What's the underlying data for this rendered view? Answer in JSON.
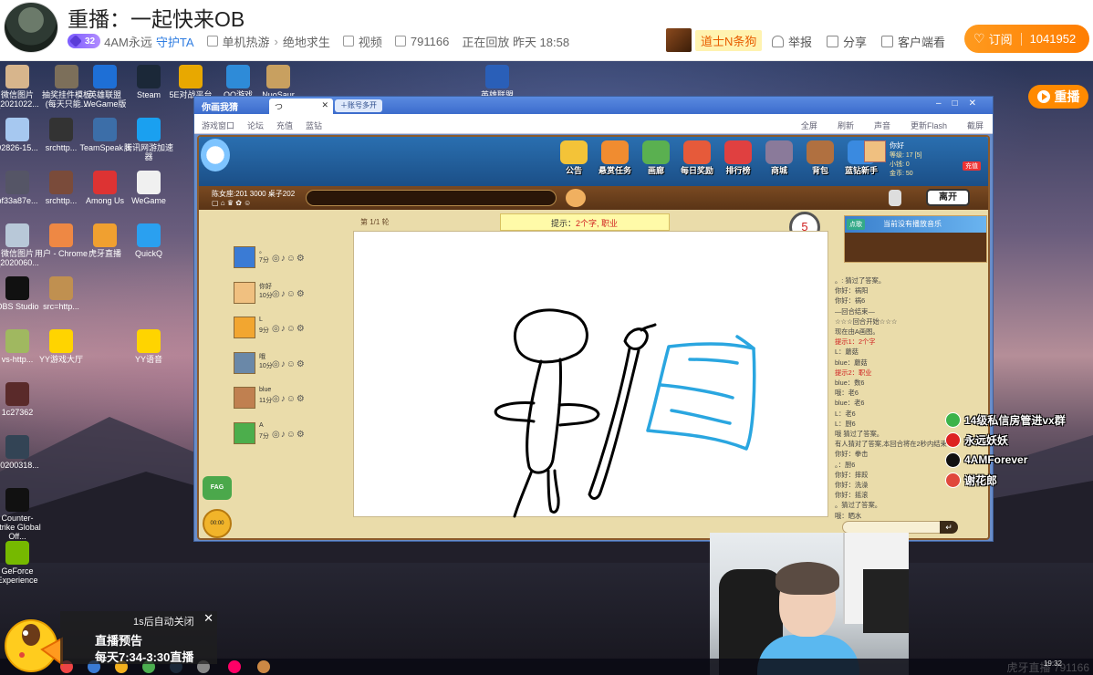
{
  "header": {
    "title": "重播：一起快来OB",
    "level": "32",
    "streamer": "4AM永远",
    "guard": "守护TA",
    "category_1": "单机热游",
    "category_2": "绝地求生",
    "video_label": "视频",
    "room_id": "791166",
    "status": "正在回放 昨天 18:58",
    "sponsor_name": "道士N条狗",
    "report": "举报",
    "share": "分享",
    "client_watch": "客户端看",
    "subscribe_label": "订阅",
    "subscribe_count": "1041952"
  },
  "stream": {
    "replay_label": "重播",
    "desktop_icons": [
      {
        "label": "微信图片_2021022..."
      },
      {
        "label": "抽奖挂件模板 (每天只能..."
      },
      {
        "label": "英雄联盟 WeGame版"
      },
      {
        "label": "Steam"
      },
      {
        "label": "5E对战平台"
      },
      {
        "label": "QQ游戏"
      },
      {
        "label": "NuoSaur"
      },
      {
        "label": "英雄联盟"
      },
      {
        "label": "92826-15..."
      },
      {
        "label": "srchttp..."
      },
      {
        "label": "TeamSpeak 3"
      },
      {
        "label": "腾讯网游加速器"
      },
      {
        "label": "bf33a87e..."
      },
      {
        "label": "srchttp..."
      },
      {
        "label": "Among Us"
      },
      {
        "label": "WeGame"
      },
      {
        "label": "微信图片_2020060..."
      },
      {
        "label": "用户 - Chrome"
      },
      {
        "label": "虎牙直播"
      },
      {
        "label": "QuickQ"
      },
      {
        "label": "OBS Studio"
      },
      {
        "label": "src=http..."
      },
      {
        "label": "vs-http..."
      },
      {
        "label": "YY游戏大厅"
      },
      {
        "label": "YY语音"
      },
      {
        "label": "1c27362"
      },
      {
        "label": "20200318..."
      },
      {
        "label": "Counter-Strike Global Off..."
      },
      {
        "label": "GeForce Experience"
      }
    ],
    "game_window": {
      "title": "你画我猜",
      "tab_label": "つ",
      "new_tab": "账号多开",
      "toolbar_links": [
        "游戏窗口",
        "论坛",
        "充值",
        "蓝钻"
      ],
      "toolbar_tools": [
        "全屏",
        "刷新",
        "声音",
        "更新Flash",
        "截屏"
      ],
      "menu": [
        "公告",
        "悬赏任务",
        "画廊",
        "每日奖励",
        "排行榜",
        "商城",
        "背包",
        "蓝钻新手"
      ],
      "user_name": "你好",
      "user_stats": [
        "等级: 17 [5]",
        "小钱: 0",
        "金币: 50"
      ],
      "recharge": "充值",
      "room": "陈女座:201 3000 桌子202",
      "leave": "离开",
      "round": "第 1/1 轮",
      "hint_prefix": "提示：",
      "hint_value": "2个字, 职业",
      "timer": "5",
      "music_label": "点歌",
      "music_text": "当前没有播放音乐",
      "fag": "FAG",
      "clock": "00:00",
      "players": [
        {
          "name": "。",
          "score": "7分"
        },
        {
          "name": "你好",
          "score": "10分"
        },
        {
          "name": "L",
          "score": "9分"
        },
        {
          "name": "哦",
          "score": "10分"
        },
        {
          "name": "blue",
          "score": "11分"
        },
        {
          "name": "A",
          "score": "7分"
        }
      ],
      "chat": [
        {
          "t": "。: 猜过了答案。"
        },
        {
          "t": "你好：祸阳"
        },
        {
          "t": "你好：祸6"
        },
        {
          "t": "—回合结束—"
        },
        {
          "t": "☆☆☆回合开始☆☆☆"
        },
        {
          "t": "现在由A画图。"
        },
        {
          "t": "提示1：2个字",
          "red": true
        },
        {
          "t": "L：蘑菇"
        },
        {
          "t": "blue：蘑菇"
        },
        {
          "t": "提示2：职业",
          "red": true
        },
        {
          "t": "blue：数6"
        },
        {
          "t": "哦：老6"
        },
        {
          "t": "blue：老6"
        },
        {
          "t": "L：老6"
        },
        {
          "t": "L：厨6"
        },
        {
          "t": "哦 猜过了答案。"
        },
        {
          "t": "有人猜对了答案,本回合将在2秒内结束"
        },
        {
          "t": "你好：拳击"
        },
        {
          "t": "。：厨6"
        },
        {
          "t": "你好：摔跤"
        },
        {
          "t": "你好：洗澡"
        },
        {
          "t": "你好：摇滚"
        },
        {
          "t": "。猜过了答案。"
        },
        {
          "t": "哦：晒水"
        }
      ]
    },
    "social": [
      "14级私信房管进vx群",
      "永远妖妖",
      "4AMForever",
      "谢花郎"
    ],
    "preview": {
      "close_note": "1s后自动关闭",
      "title": "直播预告",
      "time": "每天7:34-3:30直播"
    },
    "watermark": "虎牙直播 791166",
    "tray_time": "19:32"
  }
}
